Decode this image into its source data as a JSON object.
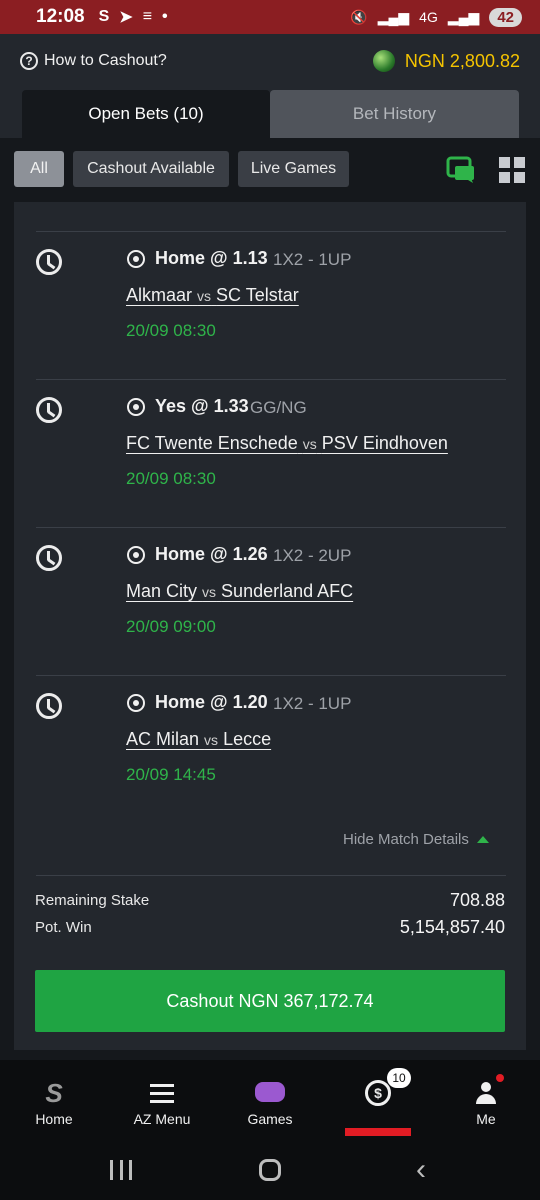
{
  "status_bar": {
    "time": "12:08",
    "left_icons": [
      "S",
      "➤",
      "≡",
      "•"
    ],
    "signal_text": "4G",
    "battery": "42"
  },
  "header": {
    "help_icon": "help-circle-icon",
    "how_to_cashout": "How to Cashout?",
    "balance": "NGN 2,800.82"
  },
  "tabs": [
    {
      "label": "Open Bets (10)",
      "active": true
    },
    {
      "label": "Bet History",
      "active": false
    }
  ],
  "filters": [
    {
      "label": "All",
      "active": true
    },
    {
      "label": "Cashout Available",
      "active": false
    },
    {
      "label": "Live Games",
      "active": false
    }
  ],
  "selections": [
    {
      "pick": "Home @ 1.13",
      "market": "1X2 - 1UP",
      "home": "Alkmaar",
      "vs": "vs",
      "away": "SC Telstar",
      "kickoff": "20/09 08:30"
    },
    {
      "pick": "Yes @ 1.33",
      "market": "GG/NG",
      "home": "FC Twente Enschede",
      "vs": "vs",
      "away": "PSV Eindhoven",
      "kickoff": "20/09 08:30"
    },
    {
      "pick": "Home @ 1.26",
      "market": "1X2 - 2UP",
      "home": "Man City",
      "vs": "vs",
      "away": "Sunderland AFC",
      "kickoff": "20/09 09:00"
    },
    {
      "pick": "Home @ 1.20",
      "market": "1X2 - 1UP",
      "home": "AC Milan",
      "vs": "vs",
      "away": "Lecce",
      "kickoff": "20/09 14:45"
    }
  ],
  "hide_details": "Hide Match Details",
  "summary": {
    "remaining_stake_label": "Remaining Stake",
    "remaining_stake": "708.88",
    "pot_win_label": "Pot. Win",
    "pot_win": "5,154,857.40"
  },
  "cashout_button": "Cashout NGN 367,172.74",
  "bottom_nav": [
    {
      "label": "Home",
      "icon": "sporty-logo-icon"
    },
    {
      "label": "AZ Menu",
      "icon": "menu-icon"
    },
    {
      "label": "Games",
      "icon": "gamepad-icon"
    },
    {
      "label": "",
      "icon": "cashout-icon",
      "badge": "10",
      "active": true
    },
    {
      "label": "Me",
      "icon": "person-icon"
    }
  ],
  "colors": {
    "accent_green": "#1fa443",
    "balance_yellow": "#f5c400",
    "status_bar_red": "#8b1e22",
    "active_red": "#e21c24"
  }
}
